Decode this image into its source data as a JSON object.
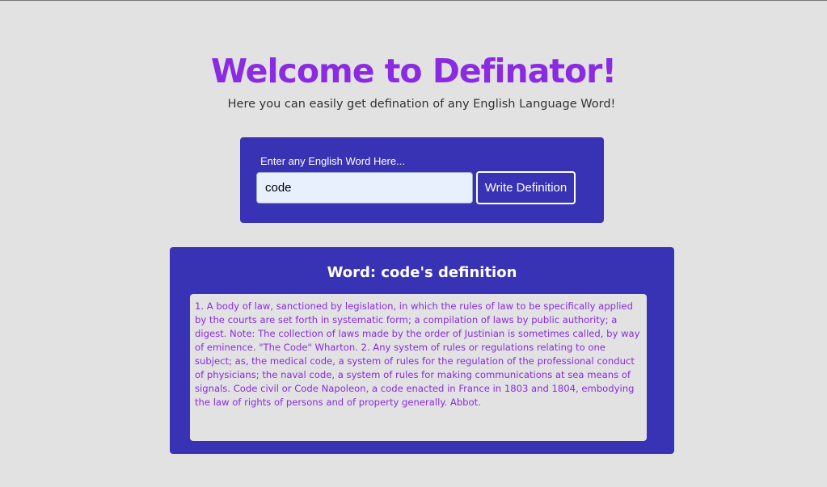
{
  "header": {
    "title": "Welcome to Definator!",
    "subtitle": "Here you can easily get defination of any English Language Word!"
  },
  "search": {
    "label": "Enter any English Word Here...",
    "value": "code",
    "button_label": "Write Definition"
  },
  "result": {
    "heading_prefix": "Word: ",
    "word": "code",
    "heading_suffix": "'s definition",
    "definition": "1. A body of law, sanctioned by legislation, in which the rules of law to be specifically applied by the courts are set forth in systematic form; a compilation of laws by public authority; a digest. Note: The collection of laws made by the order of Justinian is sometimes called, by way of eminence. \"The Code\" Wharton. 2. Any system of rules or regulations relating to one subject; as, the medical code, a system of rules for the regulation of the professional conduct of physicians; the naval code, a system of rules for making communications at sea means of signals. Code civil or Code Napoleon, a code enacted in France in 1803 and 1804, embodying the law of rights of persons and of property generally. Abbot."
  },
  "colors": {
    "background": "#e2e2e2",
    "panel": "#3832b5",
    "accent": "#8a2be2",
    "input_bg": "#e8f0fe"
  }
}
